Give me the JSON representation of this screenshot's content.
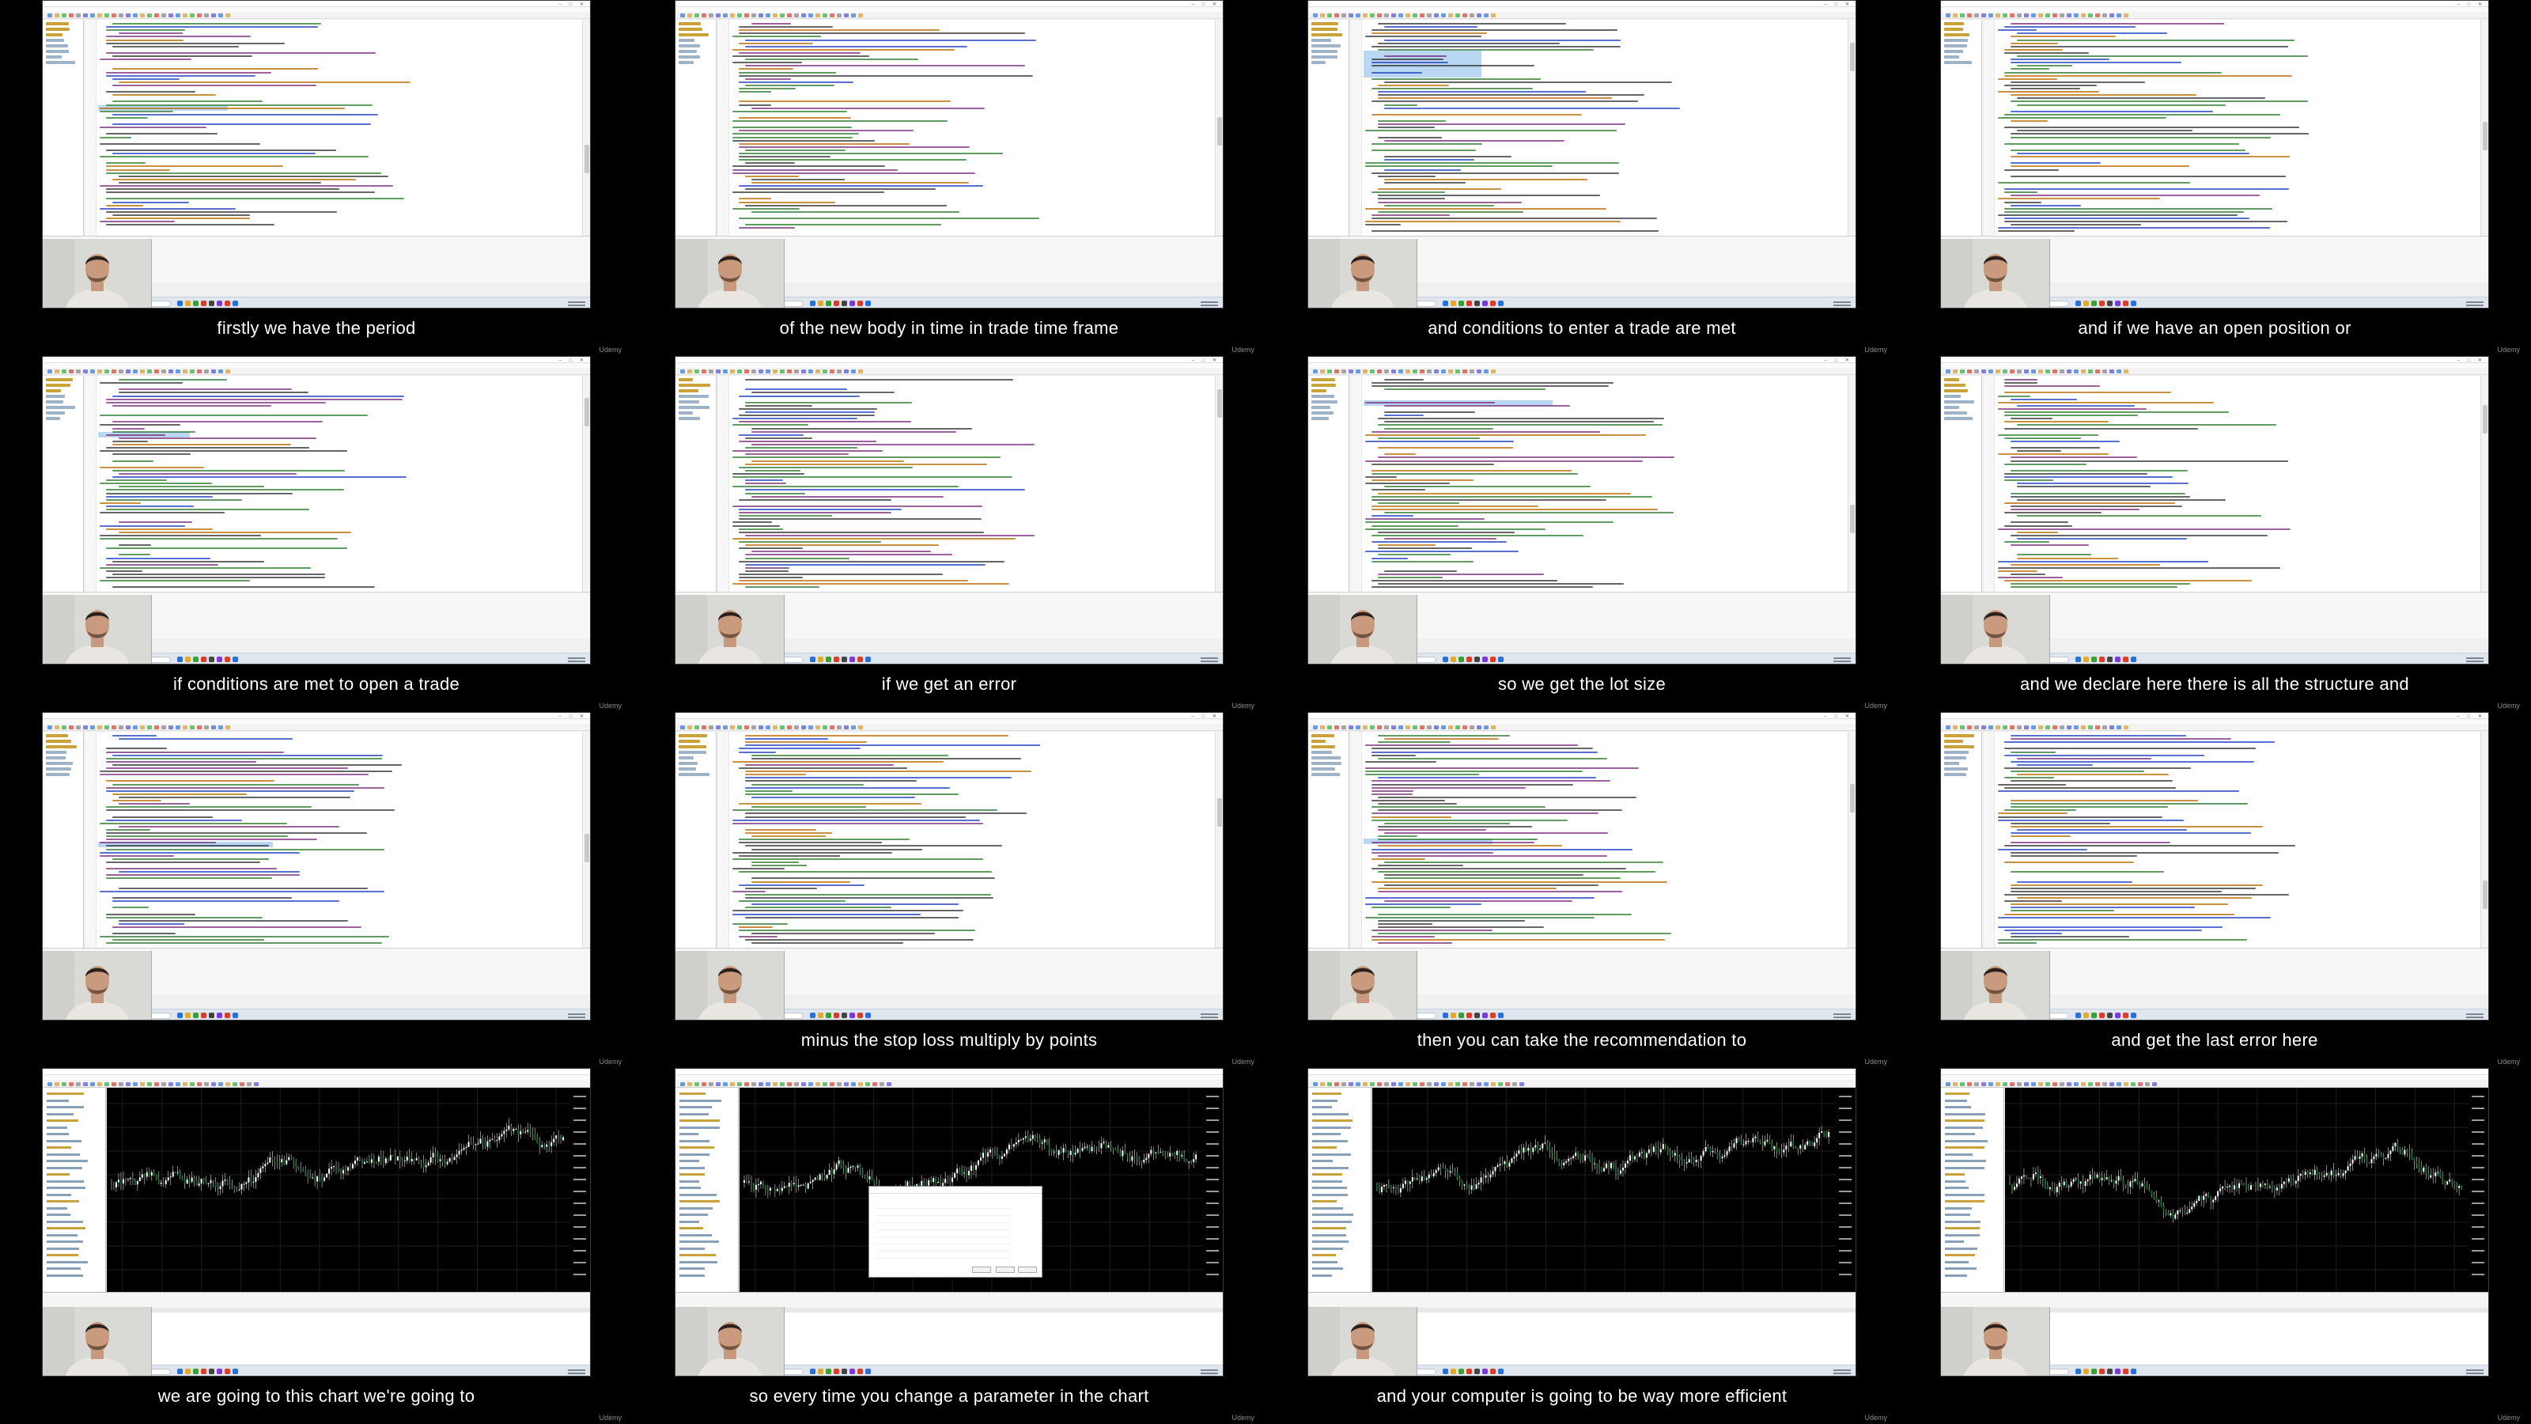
{
  "captions": [
    "firstly we have the period",
    "of the new body in time in trade time frame",
    "and conditions to enter a trade are met",
    "and if we have an open position or",
    "if conditions are met to open a trade",
    "if we get an error",
    "so we get the lot size",
    "and we declare here there is all the structure and",
    "",
    "minus the stop loss multiply by points",
    "then you can take the recommendation to",
    "and get the last error here",
    "we are going to this chart we're going to",
    "so every time you change a parameter in the chart",
    "and your computer is going to be way more efficient",
    ""
  ],
  "watermark": "Udemy",
  "colors": {
    "background": "#000000",
    "editor_bg": "#ffffff",
    "chart_bg": "#000000",
    "candle": "#ffffff",
    "selection": "#b9d7f2"
  },
  "icons": {
    "window_controls": "minimize-maximize-close-icons",
    "search": "search-icon"
  }
}
